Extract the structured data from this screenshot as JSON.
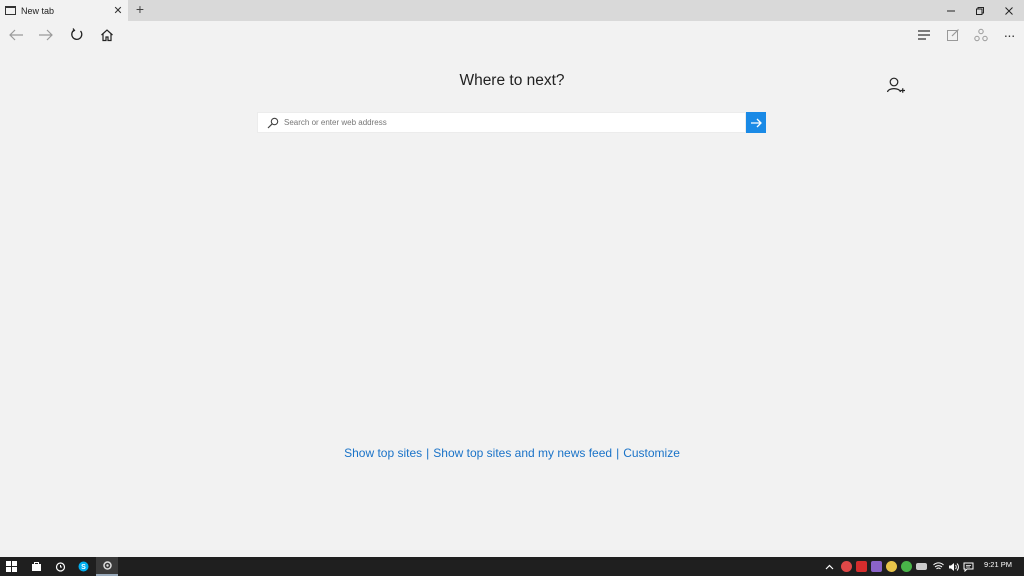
{
  "browser": {
    "tab_title": "New tab",
    "tab_close": "✕",
    "new_tab": "+"
  },
  "nav": {
    "back_icon": "arrow-left-icon",
    "forward_icon": "arrow-right-icon",
    "refresh_icon": "refresh-icon",
    "home_icon": "home-icon",
    "hub_icon": "hub-icon",
    "note_icon": "web-note-icon",
    "share_icon": "share-icon",
    "more_label": "···"
  },
  "main": {
    "heading": "Where to next?",
    "search_placeholder": "Search or enter web address",
    "links": [
      "Show top sites",
      "Show top sites and my news feed",
      "Customize"
    ],
    "separator": "|"
  },
  "taskbar": {
    "time": "9:21 PM"
  },
  "colors": {
    "accent": "#1a8ae6",
    "link": "#1a73c8",
    "taskbar": "#1f1f1f"
  }
}
